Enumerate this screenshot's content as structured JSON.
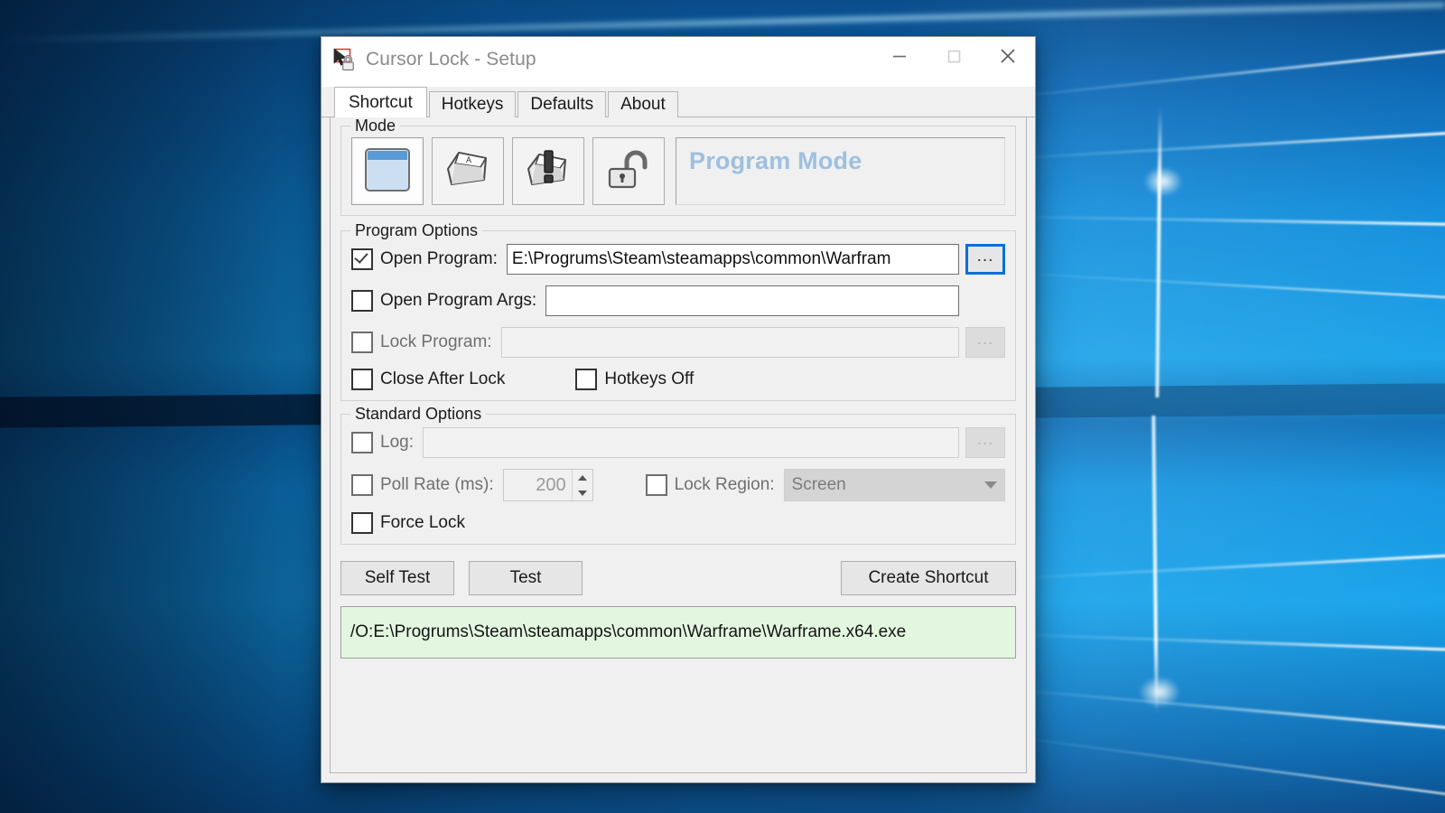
{
  "window": {
    "title": "Cursor Lock - Setup",
    "icon": "cursor-lock-icon",
    "controls": {
      "minimize": "minimize-icon",
      "maximize": "maximize-icon",
      "close": "close-icon"
    }
  },
  "tabs": [
    {
      "label": "Shortcut",
      "active": true
    },
    {
      "label": "Hotkeys",
      "active": false
    },
    {
      "label": "Defaults",
      "active": false
    },
    {
      "label": "About",
      "active": false
    }
  ],
  "mode": {
    "legend": "Mode",
    "selected_label": "Program Mode",
    "buttons": [
      {
        "icon": "window-icon",
        "selected": true
      },
      {
        "icon": "keyboard-key-icon",
        "selected": false
      },
      {
        "icon": "key-exclamation-icon",
        "selected": false
      },
      {
        "icon": "unlocked-padlock-icon",
        "selected": false
      }
    ]
  },
  "program_options": {
    "legend": "Program Options",
    "open_program": {
      "label": "Open Program:",
      "checked": true,
      "value": "E:\\Progrums\\Steam\\steamapps\\common\\Warfram",
      "browse_label": "...",
      "browse_focused": true
    },
    "open_program_args": {
      "label": "Open Program Args:",
      "checked": false,
      "value": "",
      "placeholder": ""
    },
    "lock_program": {
      "label": "Lock Program:",
      "checked": false,
      "value": "",
      "disabled": true,
      "browse_label": "..."
    },
    "close_after_lock": {
      "label": "Close After Lock",
      "checked": false
    },
    "hotkeys_off": {
      "label": "Hotkeys Off",
      "checked": false
    }
  },
  "standard_options": {
    "legend": "Standard Options",
    "log": {
      "label": "Log:",
      "checked": false,
      "value": "",
      "disabled": true,
      "browse_label": "..."
    },
    "poll_rate": {
      "label": "Poll Rate (ms):",
      "checked": false,
      "value": "200",
      "disabled": true
    },
    "lock_region": {
      "label": "Lock Region:",
      "checked": false,
      "value": "Screen",
      "disabled": true
    },
    "force_lock": {
      "label": "Force Lock",
      "checked": false
    }
  },
  "buttons": {
    "self_test": "Self Test",
    "test": "Test",
    "create_shortcut": "Create Shortcut"
  },
  "status": {
    "text": "/O:E:\\Progrums\\Steam\\steamapps\\common\\Warframe\\Warframe.x64.exe",
    "background": "#e3f7e0"
  },
  "colors": {
    "mode_label": "#9dc0e0",
    "window_chrome": "#f0f0f0",
    "focus_border": "#0a6fd8",
    "desktop": "#0a5ca8"
  }
}
